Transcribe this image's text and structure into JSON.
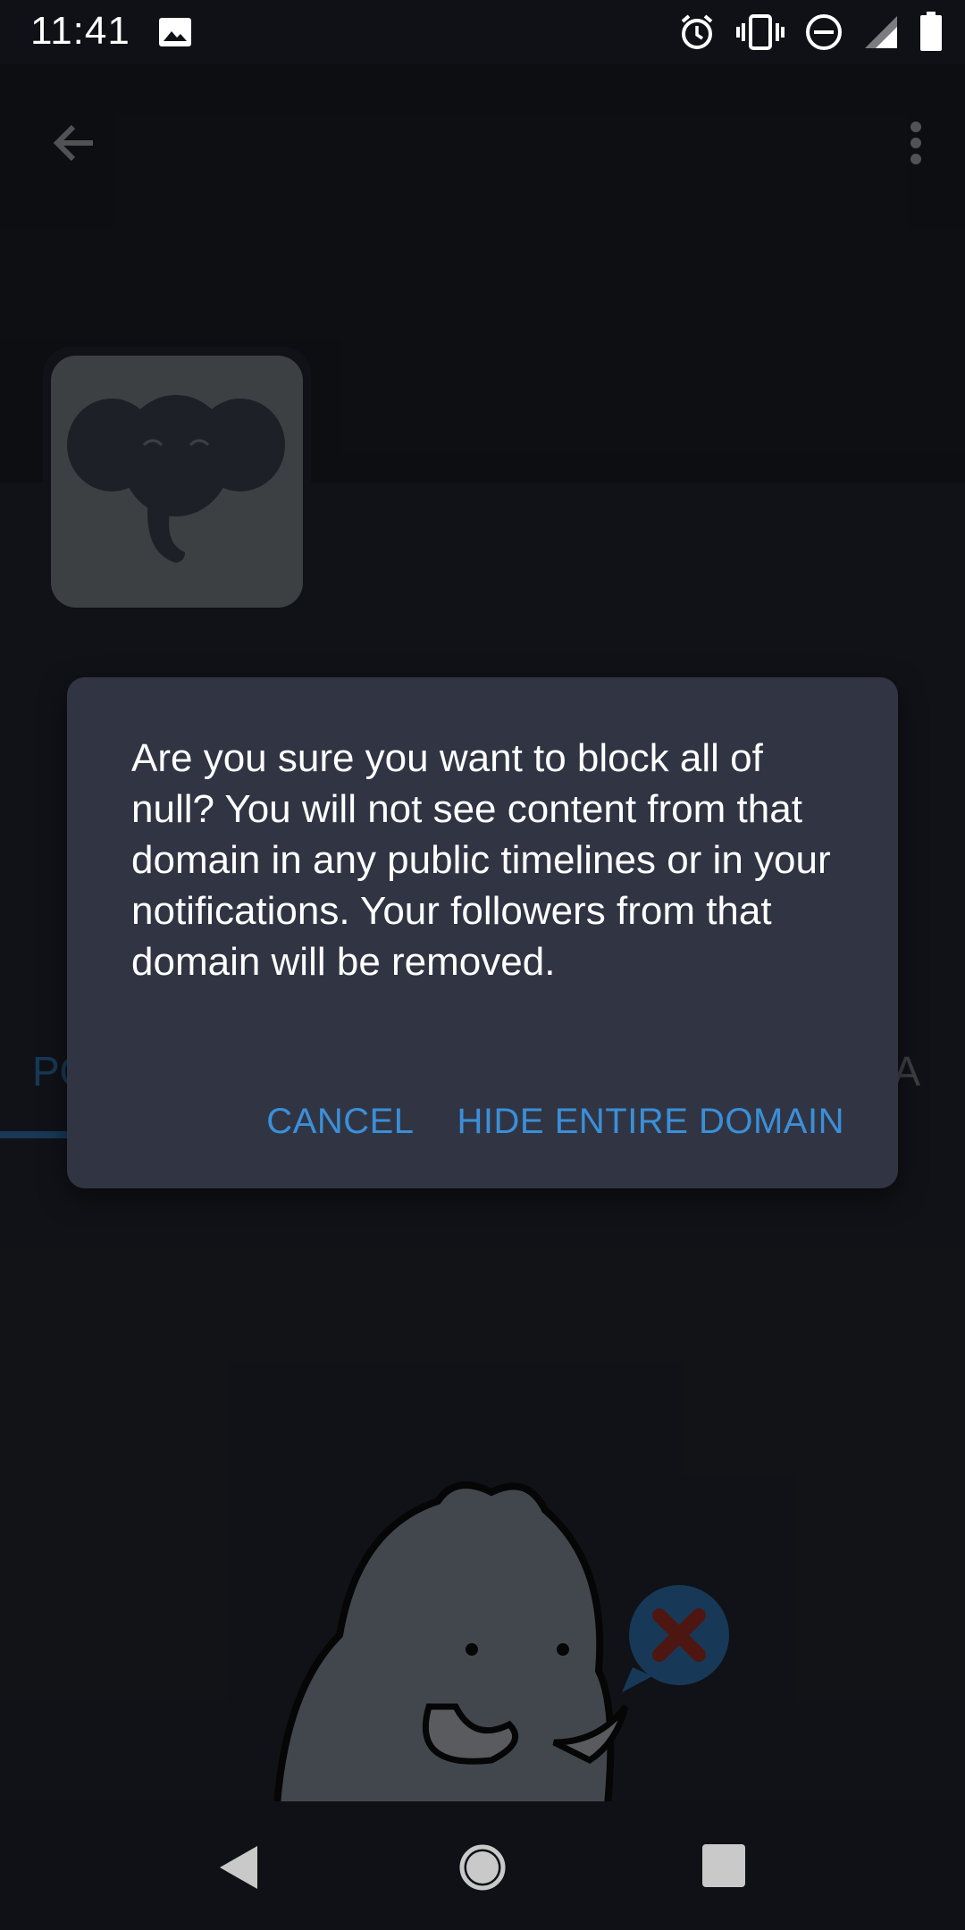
{
  "status_bar": {
    "time": "11:41"
  },
  "tabs": {
    "left_partial": "PO",
    "right_partial": "A"
  },
  "dialog": {
    "message": "Are you sure you want to block all of null? You will not see content from that domain in any public timelines or in your notifications. Your followers from that domain will be removed.",
    "cancel_label": "CANCEL",
    "confirm_label": "HIDE ENTIRE DOMAIN"
  },
  "colors": {
    "accent": "#3b8fd9",
    "dialog_bg": "#313543"
  },
  "icons": [
    "image-icon",
    "alarm-icon",
    "vibrate-icon",
    "dnd-icon",
    "signal-icon",
    "battery-icon",
    "back-arrow-icon",
    "more-vert-icon",
    "nav-back-icon",
    "nav-home-icon",
    "nav-recents-icon"
  ]
}
